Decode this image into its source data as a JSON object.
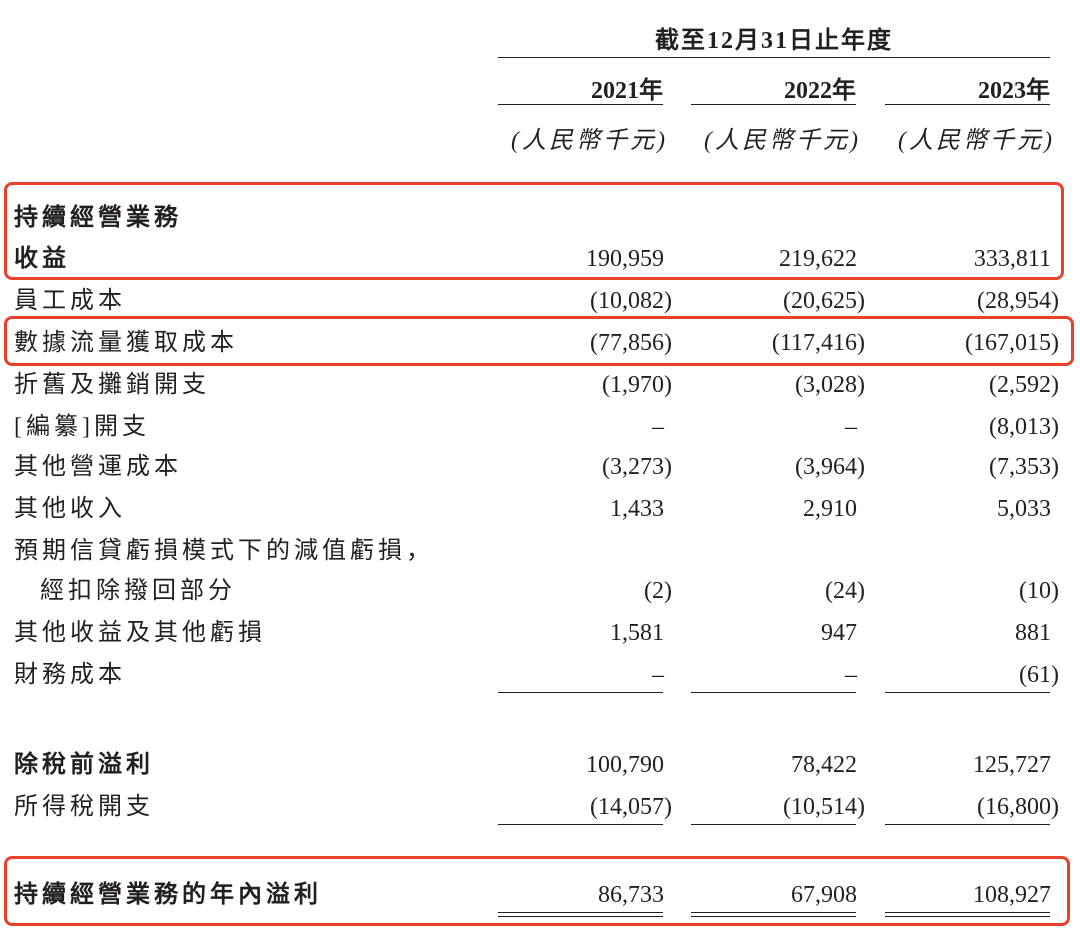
{
  "header": {
    "period": "截至12月31日止年度",
    "years": [
      "2021年",
      "2022年",
      "2023年"
    ],
    "unit": "(人民幣千元)"
  },
  "rows": [
    {
      "label": "持續經營業務",
      "bold": true,
      "values": [
        "",
        "",
        ""
      ]
    },
    {
      "label": "收益",
      "bold": true,
      "values": [
        "190,959",
        "219,622",
        "333,811"
      ]
    },
    {
      "label": "員工成本",
      "bold": false,
      "values": [
        "(10,082)",
        "(20,625)",
        "(28,954)"
      ]
    },
    {
      "label": "數據流量獲取成本",
      "bold": false,
      "values": [
        "(77,856)",
        "(117,416)",
        "(167,015)"
      ]
    },
    {
      "label": "折舊及攤銷開支",
      "bold": false,
      "values": [
        "(1,970)",
        "(3,028)",
        "(2,592)"
      ]
    },
    {
      "label": "[編纂]開支",
      "bold": false,
      "values": [
        "–",
        "–",
        "(8,013)"
      ]
    },
    {
      "label": "其他營運成本",
      "bold": false,
      "values": [
        "(3,273)",
        "(3,964)",
        "(7,353)"
      ]
    },
    {
      "label": "其他收入",
      "bold": false,
      "values": [
        "1,433",
        "2,910",
        "5,033"
      ]
    },
    {
      "label": "預期信貸虧損模式下的減值虧損，",
      "bold": false,
      "values": [
        "",
        "",
        ""
      ]
    },
    {
      "label": "經扣除撥回部分",
      "bold": false,
      "indent": true,
      "values": [
        "(2)",
        "(24)",
        "(10)"
      ]
    },
    {
      "label": "其他收益及其他虧損",
      "bold": false,
      "values": [
        "1,581",
        "947",
        "881"
      ]
    },
    {
      "label": "財務成本",
      "bold": false,
      "values": [
        "–",
        "–",
        "(61)"
      ]
    },
    {
      "label": "除稅前溢利",
      "bold": true,
      "values": [
        "100,790",
        "78,422",
        "125,727"
      ]
    },
    {
      "label": "所得稅開支",
      "bold": false,
      "values": [
        "(14,057)",
        "(10,514)",
        "(16,800)"
      ]
    },
    {
      "label": "持續經營業務的年內溢利",
      "bold": true,
      "values": [
        "86,733",
        "67,908",
        "108,927"
      ]
    }
  ],
  "highlight_color": "#e8412b"
}
